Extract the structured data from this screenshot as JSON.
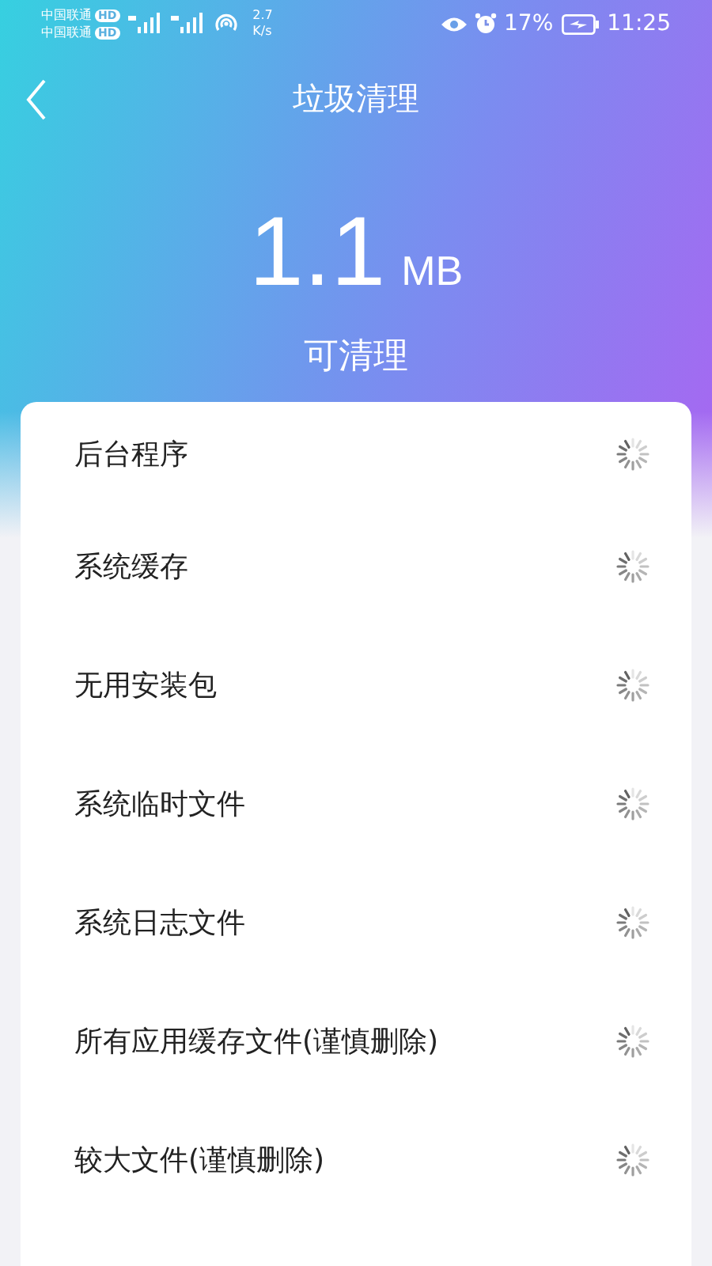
{
  "status_bar": {
    "carriers": [
      {
        "name": "中国联通",
        "badge": "HD"
      },
      {
        "name": "中国联通",
        "badge": "HD"
      }
    ],
    "speed_value": "2.7",
    "speed_unit": "K/s",
    "battery": "17%",
    "time": "11:25"
  },
  "title": "垃圾清理",
  "summary": {
    "value": "1.1",
    "unit": "MB",
    "label": "可清理"
  },
  "items": [
    {
      "name": "后台程序"
    },
    {
      "name": "系统缓存"
    },
    {
      "name": "无用安装包"
    },
    {
      "name": "系统临时文件"
    },
    {
      "name": "系统日志文件"
    },
    {
      "name": "所有应用缓存文件(谨慎删除)"
    },
    {
      "name": "较大文件(谨慎删除)"
    }
  ]
}
